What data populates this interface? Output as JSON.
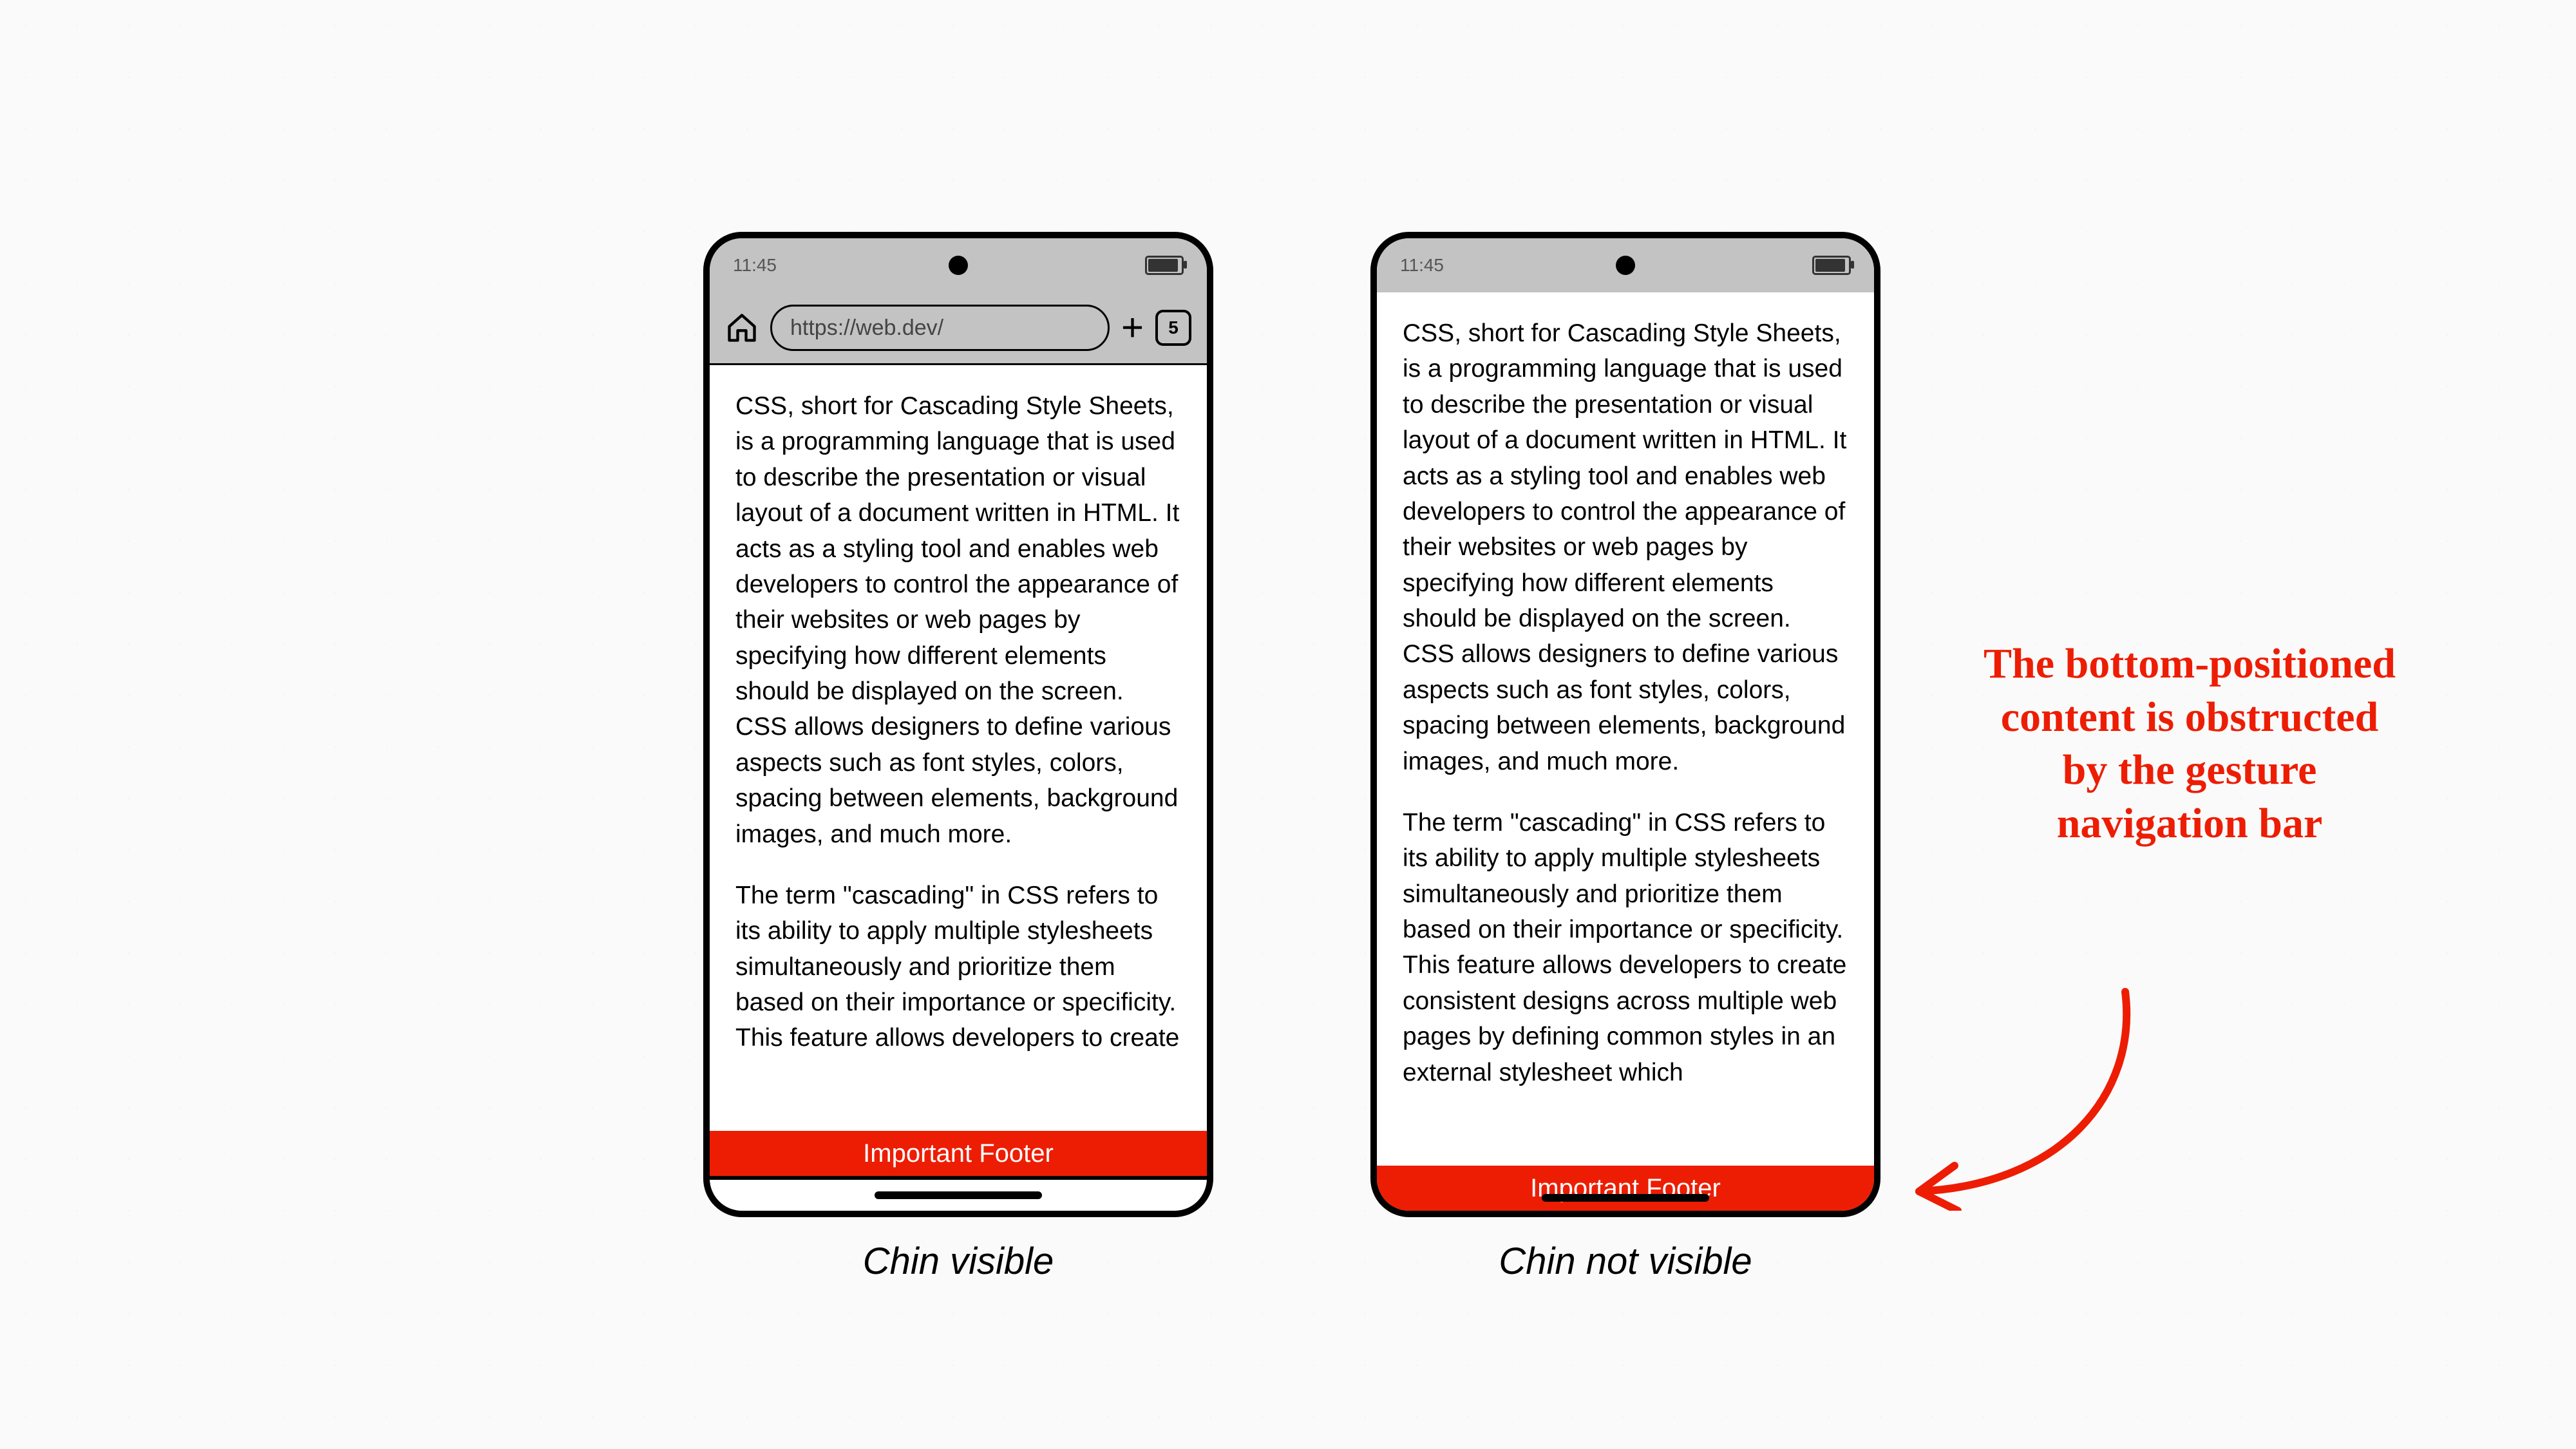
{
  "status": {
    "time": "11:45"
  },
  "browser": {
    "url": "https://web.dev/",
    "tab_count": "5"
  },
  "article": {
    "para1": "CSS, short for Cascading Style Sheets, is a programming language that is used to describe the presentation or visual layout of a document written in HTML. It acts as a styling tool and enables web developers to control the appearance of their websites or web pages by specifying how different elements should be displayed on the screen. CSS allows designers to define various aspects such as font styles, colors, spacing between elements, background images, and much more.",
    "para2_left": "The term \"cascading\" in CSS refers to its ability to apply multiple stylesheets simultaneously and prioritize them based on their importance or specificity. This feature allows developers to create",
    "para2_right": "The term \"cascading\" in CSS refers to its ability to apply multiple stylesheets simultaneously and prioritize them based on their importance or specificity. This feature allows developers to create consistent designs across multiple web pages by defining common styles in an external stylesheet which"
  },
  "footer": {
    "label": "Important Footer"
  },
  "captions": {
    "left": "Chin visible",
    "right": "Chin not visible"
  },
  "annotation": "The bottom-positioned content is obstructed by the gesture navigation bar",
  "colors": {
    "accent": "#ed1d04"
  }
}
